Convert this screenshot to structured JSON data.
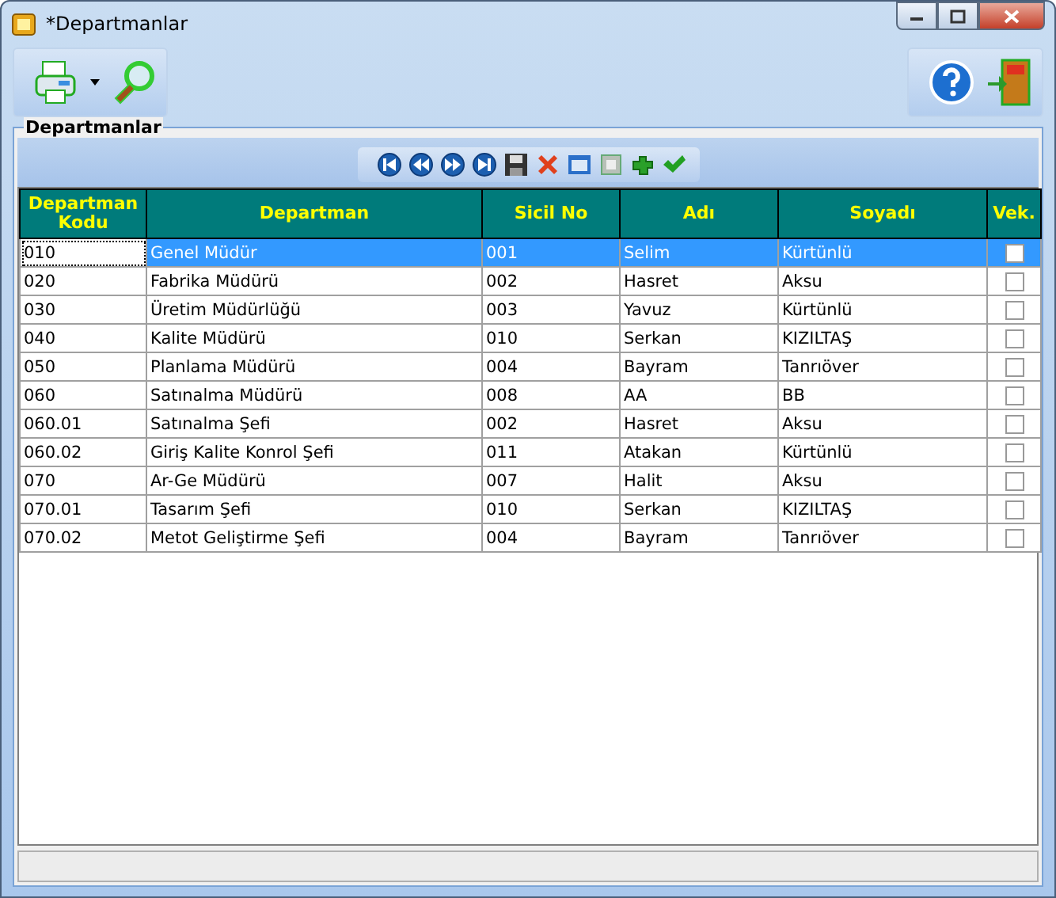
{
  "window": {
    "title": "*Departmanlar"
  },
  "group": {
    "title": "Departmanlar"
  },
  "table": {
    "columns": [
      "Departman Kodu",
      "Departman",
      "Sicil No",
      "Adı",
      "Soyadı",
      "Vek."
    ],
    "rows": [
      {
        "cells": [
          "010",
          "Genel Müdür",
          "001",
          "Selim",
          "Kürtünlü"
        ],
        "vek": false,
        "selected": true
      },
      {
        "cells": [
          "020",
          "Fabrika Müdürü",
          "002",
          "Hasret",
          "Aksu"
        ],
        "vek": false,
        "selected": false
      },
      {
        "cells": [
          "030",
          "Üretim Müdürlüğü",
          "003",
          "Yavuz",
          "Kürtünlü"
        ],
        "vek": false,
        "selected": false
      },
      {
        "cells": [
          "040",
          "Kalite Müdürü",
          "010",
          "Serkan",
          "KIZILTAŞ"
        ],
        "vek": false,
        "selected": false
      },
      {
        "cells": [
          "050",
          "Planlama Müdürü",
          "004",
          "Bayram",
          "Tanrıöver"
        ],
        "vek": false,
        "selected": false
      },
      {
        "cells": [
          "060",
          "Satınalma Müdürü",
          "008",
          "AA",
          "BB"
        ],
        "vek": false,
        "selected": false
      },
      {
        "cells": [
          "060.01",
          "Satınalma Şefi",
          "002",
          "Hasret",
          "Aksu"
        ],
        "vek": false,
        "selected": false
      },
      {
        "cells": [
          "060.02",
          "Giriş Kalite Konrol Şefi",
          "011",
          "Atakan",
          "Kürtünlü"
        ],
        "vek": false,
        "selected": false
      },
      {
        "cells": [
          "070",
          "Ar-Ge Müdürü",
          "007",
          "Halit",
          "Aksu"
        ],
        "vek": false,
        "selected": false
      },
      {
        "cells": [
          "070.01",
          "Tasarım Şefi",
          "010",
          "Serkan",
          "KIZILTAŞ"
        ],
        "vek": false,
        "selected": false
      },
      {
        "cells": [
          "070.02",
          "Metot Geliştirme Şefi",
          "004",
          "Bayram",
          "Tanrıöver"
        ],
        "vek": false,
        "selected": false
      }
    ]
  }
}
